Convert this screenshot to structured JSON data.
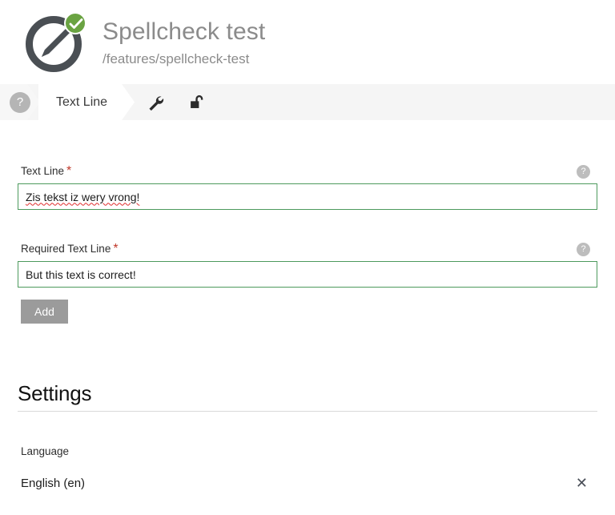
{
  "header": {
    "title": "Spellcheck test",
    "subtitle": "/features/spellcheck-test",
    "logo_icon": "pencil-in-circle-icon",
    "status_icon": "green-check-badge-icon",
    "accent_green": "#6aa342",
    "title_color": "#8b8b8b"
  },
  "tabs": {
    "help_glyph": "?",
    "active_label": "Text Line",
    "tools_icon": "wrench-icon",
    "lock_icon": "unlocked-padlock-icon",
    "bar_background": "#f5f5f5"
  },
  "form": {
    "help_glyph": "?",
    "required_marker": "*",
    "fields": [
      {
        "label": "Text Line",
        "required": true,
        "value": "Zis tekst iz wery vrong!",
        "spellcheck_error": true,
        "border_color": "#4d9a5d"
      },
      {
        "label": "Required Text Line",
        "required": true,
        "value": "But this text is correct!",
        "spellcheck_error": false,
        "border_color": "#4d9a5d"
      }
    ],
    "add_label": "Add",
    "add_color": "#9b9b9b"
  },
  "settings": {
    "heading": "Settings",
    "language_label": "Language",
    "language_value": "English (en)",
    "remove_glyph": "✕"
  }
}
